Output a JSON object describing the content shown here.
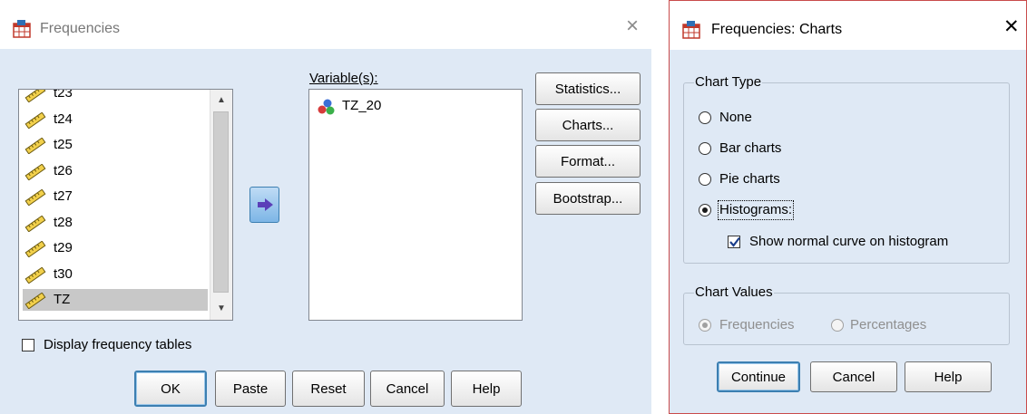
{
  "frequencies": {
    "title": "Frequencies",
    "close_icon": "×",
    "source_variables": [
      "t23",
      "t24",
      "t25",
      "t26",
      "t27",
      "t28",
      "t29",
      "t30",
      "TZ"
    ],
    "selected_source_variable": "TZ",
    "variables_label": "Variable(s):",
    "target_variables": [
      "TZ_20"
    ],
    "side_buttons": {
      "statistics": "Statistics...",
      "charts": "Charts...",
      "format": "Format...",
      "bootstrap": "Bootstrap..."
    },
    "display_frequency_tables_label": "Display frequency tables",
    "display_frequency_tables_checked": false,
    "bottom_buttons": {
      "ok": "OK",
      "paste": "Paste",
      "reset": "Reset",
      "cancel": "Cancel",
      "help": "Help"
    }
  },
  "charts_dialog": {
    "title": "Frequencies: Charts",
    "close_icon": "✕",
    "chart_type_legend": "Chart Type",
    "chart_type_options": {
      "none": "None",
      "bar": "Bar charts",
      "pie": "Pie charts",
      "histograms": "Histograms:"
    },
    "chart_type_selected": "histograms",
    "show_normal_curve_label": "Show normal curve on histogram",
    "show_normal_curve_checked": true,
    "chart_values_legend": "Chart Values",
    "chart_values_options": {
      "frequencies": "Frequencies",
      "percentages": "Percentages"
    },
    "chart_values_selected": "frequencies",
    "buttons": {
      "continue": "Continue",
      "cancel": "Cancel",
      "help": "Help"
    }
  },
  "colors": {
    "dialog_bg": "#dfe9f5",
    "accent": "#3c7fb1",
    "charts_border": "#c94b4b",
    "disabled_text": "#8f8f8f"
  },
  "icons": {
    "app": "spss-table-icon",
    "scale_variable": "ruler-icon",
    "nominal_variable": "three-balls-icon",
    "move_arrow": "right-arrow-icon"
  }
}
